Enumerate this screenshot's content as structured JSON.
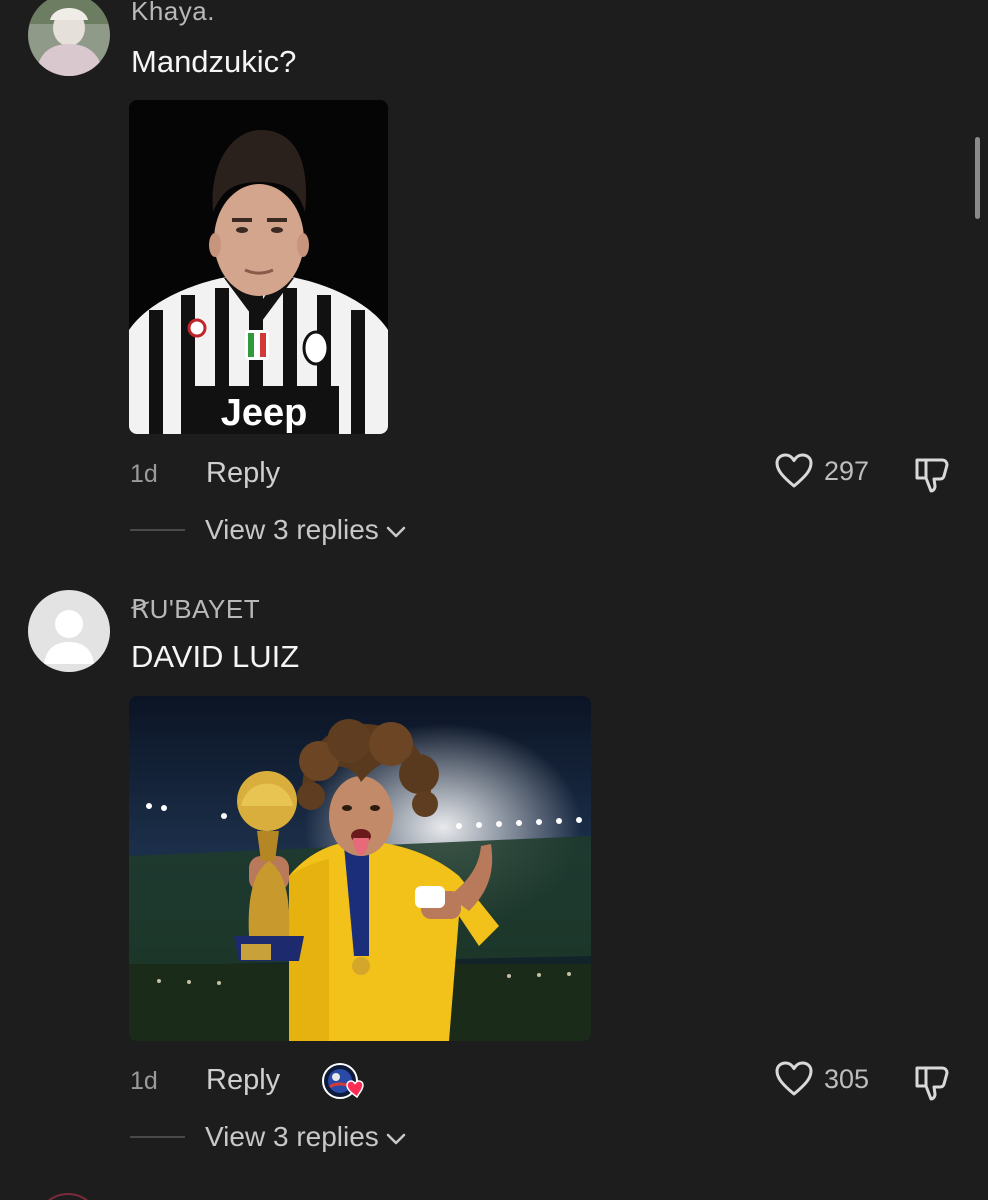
{
  "comments": [
    {
      "username": "Khaya.",
      "text": "Mandzukic?",
      "time": "1d",
      "reply_label": "Reply",
      "likes": "297",
      "view_replies": "View 3 replies",
      "avatar_icon": "user-photo-avatar",
      "image": "photo-mandzukic-juventus-jersey",
      "jersey_sponsor": "Jeep"
    },
    {
      "username": "ꞦU'BAYET",
      "text": "DAVID LUIZ",
      "time": "1d",
      "reply_label": "Reply",
      "likes": "305",
      "view_replies": "View 3 replies",
      "avatar_icon": "default-avatar",
      "image": "photo-david-luiz-trophy",
      "creator_liked": true
    }
  ],
  "icons": {
    "like": "heart-outline-icon",
    "dislike": "thumbs-down-icon",
    "chevron": "chevron-down-icon",
    "creator_like": "creator-liked-badge"
  },
  "colors": {
    "background": "#1d1d1d",
    "liked_heart": "#fe2c55"
  }
}
